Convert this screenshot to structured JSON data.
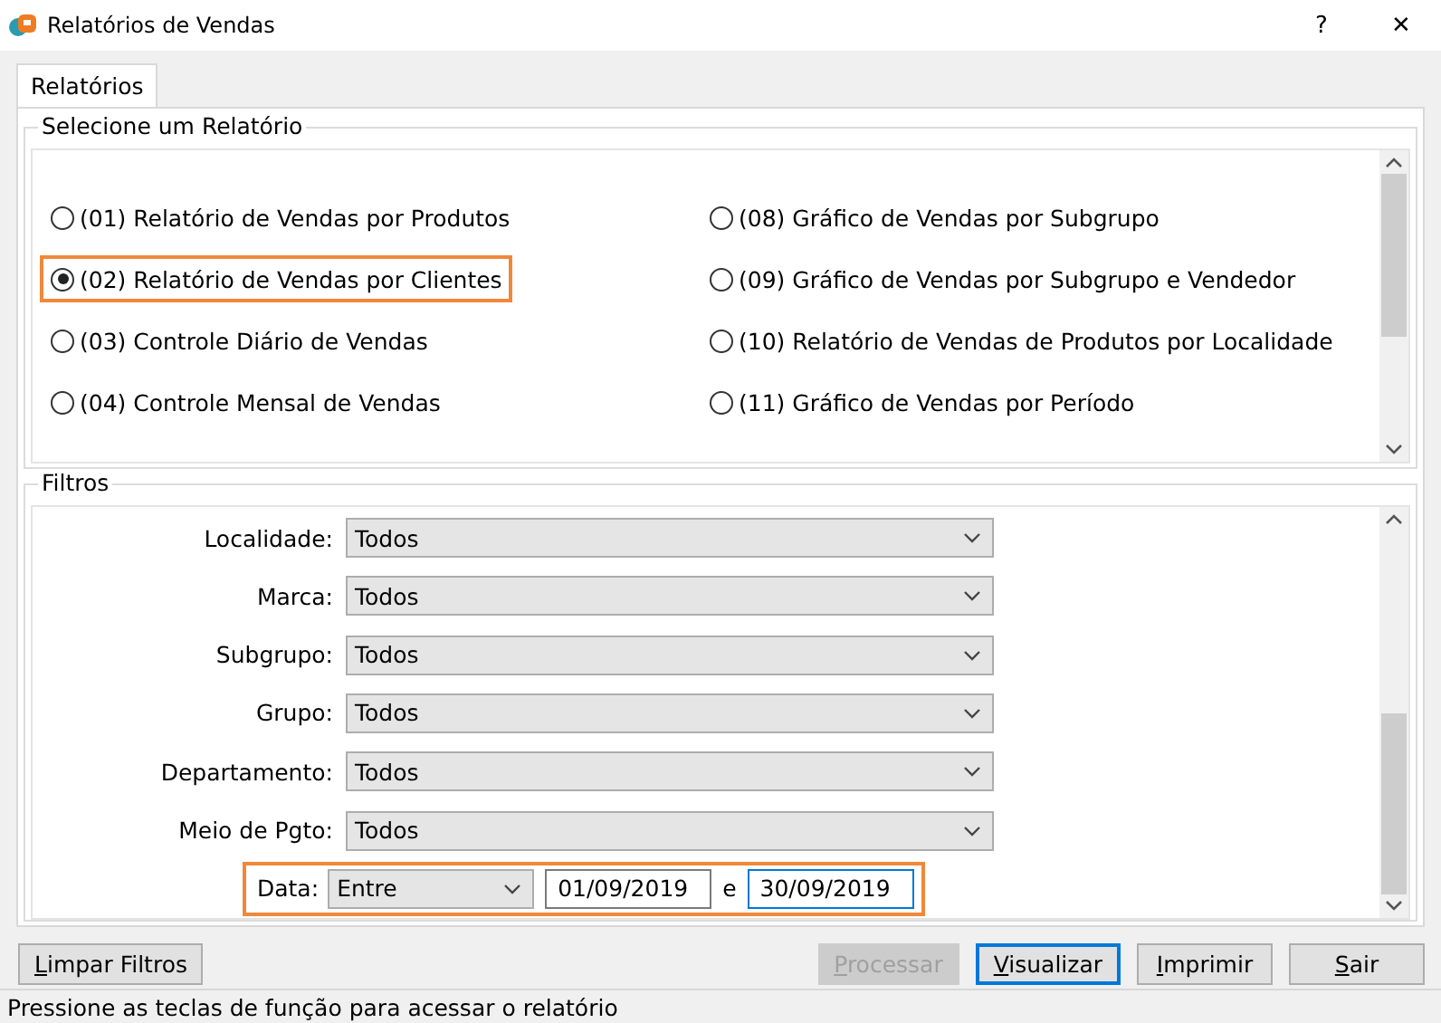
{
  "window": {
    "title": "Relatórios de Vendas",
    "help": "?",
    "close": "✕"
  },
  "tabs": [
    {
      "label": "Relatórios",
      "selected": true
    }
  ],
  "report_group": {
    "title": "Selecione um Relatório",
    "columns": [
      [
        {
          "label": "(01) Relatório de Vendas por Produtos",
          "selected": false,
          "highlighted": false
        },
        {
          "label": "(02) Relatório de Vendas por Clientes",
          "selected": true,
          "highlighted": true
        },
        {
          "label": "(03) Controle Diário de Vendas",
          "selected": false,
          "highlighted": false
        },
        {
          "label": "(04) Controle Mensal de Vendas",
          "selected": false,
          "highlighted": false
        }
      ],
      [
        {
          "label": "(08) Gráfico de Vendas por Subgrupo",
          "selected": false,
          "highlighted": false
        },
        {
          "label": "(09) Gráfico de Vendas por Subgrupo e Vendedor",
          "selected": false,
          "highlighted": false
        },
        {
          "label": "(10) Relatório de Vendas de Produtos por Localidade",
          "selected": false,
          "highlighted": false
        },
        {
          "label": "(11) Gráfico de Vendas por Período",
          "selected": false,
          "highlighted": false
        }
      ]
    ]
  },
  "filters": {
    "title": "Filtros",
    "rows": [
      {
        "kind": "combo",
        "label": "Localidade:",
        "value": "Todos"
      },
      {
        "kind": "combo",
        "label": "Marca:",
        "value": "Todos"
      },
      {
        "kind": "combo",
        "label": "Subgrupo:",
        "value": "Todos"
      },
      {
        "kind": "combo",
        "label": "Grupo:",
        "value": "Todos"
      },
      {
        "kind": "combo",
        "label": "Departamento:",
        "value": "Todos"
      },
      {
        "kind": "combo",
        "label": "Meio de Pgto:",
        "value": "Todos"
      },
      {
        "kind": "date_range",
        "label": "Data:",
        "value": "Entre",
        "from": "01/09/2019",
        "separator": "e",
        "to": "30/09/2019",
        "highlighted": true
      }
    ]
  },
  "buttons": [
    {
      "label": "Limpar Filtros",
      "disabled": false,
      "default": false
    },
    {
      "label": "Processar",
      "disabled": true,
      "default": false
    },
    {
      "label": "Visualizar",
      "disabled": false,
      "default": true
    },
    {
      "label": "Imprimir",
      "disabled": false,
      "default": false
    },
    {
      "label": "Sair",
      "disabled": false,
      "default": false
    }
  ],
  "status_bar": "Pressione as teclas de função para acessar o relatório"
}
